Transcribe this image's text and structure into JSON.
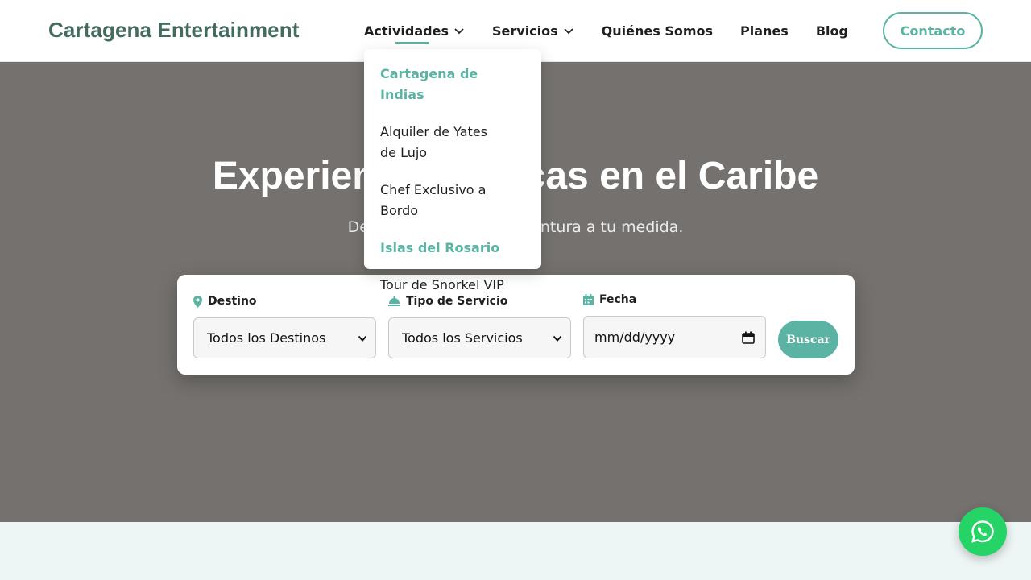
{
  "header": {
    "brand": "Cartagena Entertainment",
    "nav": [
      {
        "label": "Actividades"
      },
      {
        "label": "Servicios"
      },
      {
        "label": "Quiénes Somos"
      },
      {
        "label": "Planes"
      },
      {
        "label": "Blog"
      }
    ],
    "contact_label": "Contacto"
  },
  "dropdown": {
    "items": [
      {
        "label": "Cartagena de Indias",
        "highlighted": true
      },
      {
        "label": "Alquiler de Yates de Lujo",
        "highlighted": false
      },
      {
        "label": "Chef Exclusivo a Bordo",
        "highlighted": false
      },
      {
        "label": "Islas del Rosario",
        "highlighted": true
      },
      {
        "label": "Tour de Snorkel VIP",
        "highlighted": false
      }
    ]
  },
  "hero": {
    "title": "Experiencias Únicas en el Caribe",
    "subtitle": "Descubre tu próxima aventura a tu medida."
  },
  "search": {
    "destino_label": "Destino",
    "destino_value": "Todos los Destinos",
    "servicio_label": "Tipo de Servicio",
    "servicio_value": "Todos los Servicios",
    "fecha_label": "Fecha",
    "fecha_placeholder": "mm/dd/yyyy",
    "button_label": "Buscar"
  },
  "colors": {
    "accent": "#5ab3a3",
    "brand": "#456b60",
    "hero_overlay": "#74716e",
    "whatsapp": "#25d366"
  },
  "icons": [
    "chevron-down-icon",
    "map-pin-icon",
    "service-bell-icon",
    "calendar-icon",
    "whatsapp-icon"
  ]
}
